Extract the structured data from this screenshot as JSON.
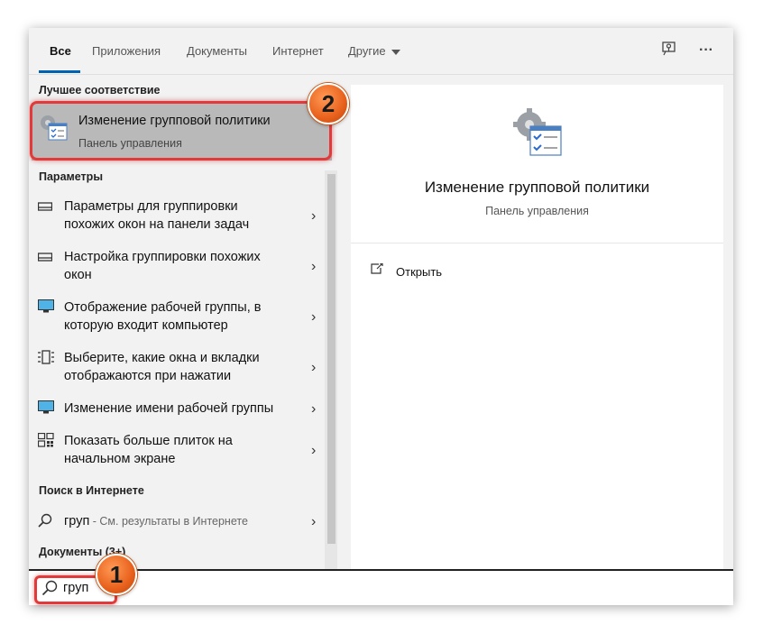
{
  "tabs": [
    {
      "label": "Все",
      "active": true
    },
    {
      "label": "Приложения"
    },
    {
      "label": "Документы"
    },
    {
      "label": "Интернет"
    },
    {
      "label": "Другие"
    }
  ],
  "top_icons": [
    "feedback-icon",
    "more-icon"
  ],
  "more_label": "···",
  "left": {
    "best_match_header": "Лучшее соответствие",
    "best_match": {
      "title": "Изменение групповой политики",
      "subtitle": "Панель управления",
      "icon": "group-policy-icon"
    },
    "settings_header": "Параметры",
    "settings_items": [
      {
        "line1": "Параметры для группировки",
        "line2": "похожих окон на панели задач",
        "icon": "taskbar-icon"
      },
      {
        "line1": "Настройка группировки похожих",
        "line2": "окон",
        "icon": "taskbar-icon"
      },
      {
        "line1": "Отображение рабочей группы, в",
        "line2": "которую входит компьютер",
        "icon": "monitor-icon"
      },
      {
        "line1": "Выберите, какие окна и вкладки",
        "line2": "отображаются при нажатии",
        "icon": "window-list-icon"
      },
      {
        "line1": "Изменение имени рабочей группы",
        "line2": "",
        "icon": "monitor-icon"
      },
      {
        "line1": "Показать больше плиток на",
        "line2": "начальном экране",
        "icon": "tiles-icon"
      }
    ],
    "web_header": "Поиск в Интернете",
    "web_item": {
      "query": "груп",
      "suffix": " - См. результаты в Интернете"
    },
    "docs_header": "Документы (3+)"
  },
  "right": {
    "title": "Изменение групповой политики",
    "subtitle": "Панель управления",
    "open_label": "Открыть"
  },
  "search": {
    "value": "груп"
  },
  "markers": {
    "one": "1",
    "two": "2"
  },
  "colors": {
    "accent": "#0063b1",
    "highlight": "#e23a3a",
    "marker": "#e8611c",
    "selected_bg": "#b9b9b9"
  }
}
